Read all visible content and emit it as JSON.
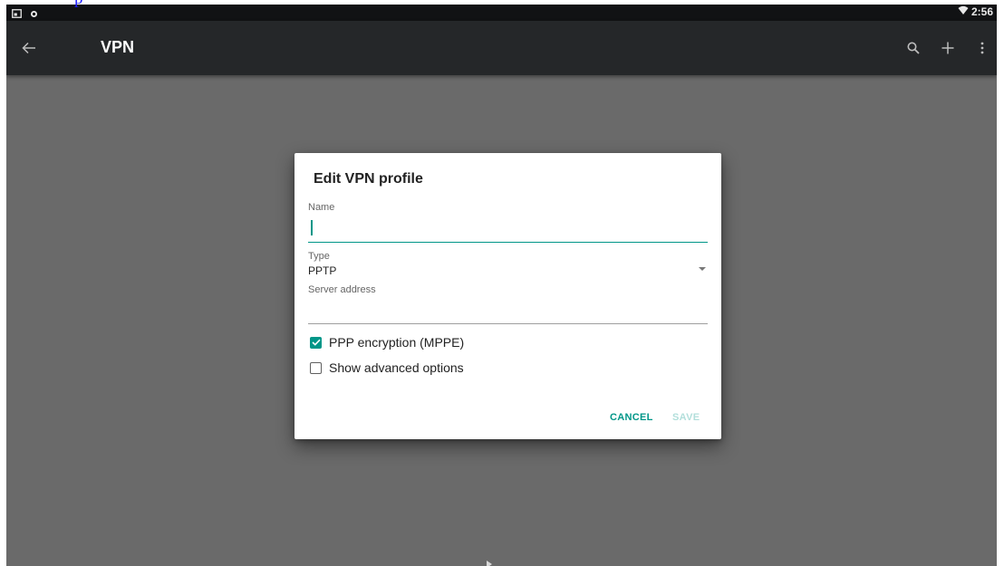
{
  "top_link": "p",
  "status_bar": {
    "time": "2:56",
    "icons": [
      "screenshot-icon",
      "notification-dot-icon",
      "wifi-icon"
    ]
  },
  "app_bar": {
    "title": "VPN",
    "icons": [
      "back-arrow-icon",
      "search-icon",
      "add-icon",
      "overflow-menu-icon"
    ]
  },
  "dialog": {
    "title": "Edit VPN profile",
    "name_label": "Name",
    "name_value": "",
    "type_label": "Type",
    "type_value": "PPTP",
    "server_label": "Server address",
    "server_value": "",
    "options": [
      {
        "label": "PPP encryption (MPPE)",
        "checked": true
      },
      {
        "label": "Show advanced options",
        "checked": false
      }
    ],
    "cancel_label": "CANCEL",
    "save_label": "SAVE"
  },
  "colors": {
    "accent": "#009688",
    "accent_disabled": "#b2dfdb",
    "app_bar": "#252729",
    "status_bar": "#111214",
    "scrim": "#6a6a6a"
  }
}
